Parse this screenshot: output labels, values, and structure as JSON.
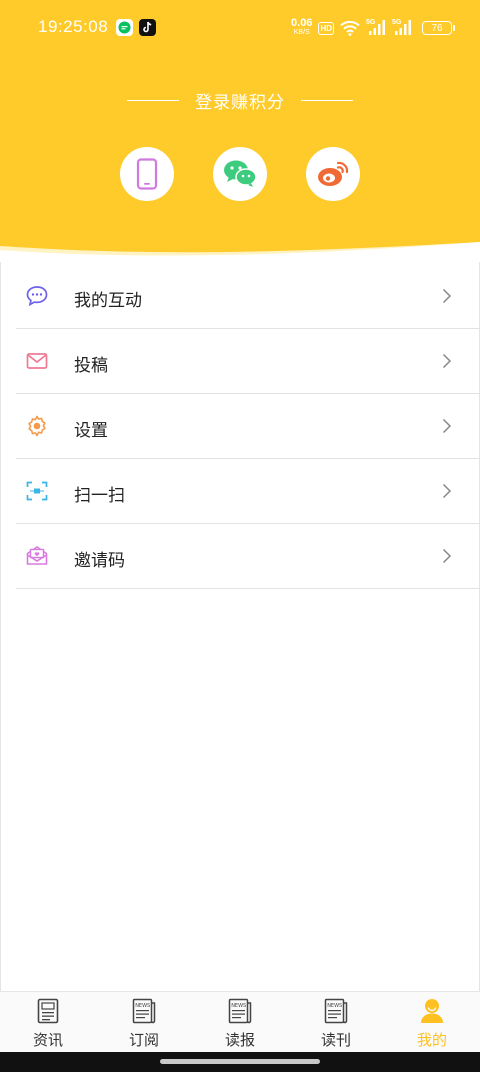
{
  "status_bar": {
    "time": "19:25:08",
    "net_speed_value": "0.06",
    "net_speed_unit": "KB/S",
    "hd_label": "HD",
    "signal_1_label": "5G",
    "signal_2_label": "5G",
    "battery": "76"
  },
  "header": {
    "login_title": "登录赚积分",
    "login_options": [
      "phone-icon",
      "wechat-icon",
      "weibo-icon"
    ],
    "background_color": "#FFCB2B"
  },
  "menu": {
    "items": [
      {
        "label": "我的互动",
        "icon": "chat-bubble-icon"
      },
      {
        "label": "投稿",
        "icon": "envelope-icon"
      },
      {
        "label": "设置",
        "icon": "gear-icon"
      },
      {
        "label": "扫一扫",
        "icon": "scan-icon"
      },
      {
        "label": "邀请码",
        "icon": "invite-mail-icon"
      }
    ]
  },
  "tabbar": {
    "tabs": [
      {
        "label": "资讯",
        "icon": "document-icon"
      },
      {
        "label": "订阅",
        "icon": "newspaper-icon"
      },
      {
        "label": "读报",
        "icon": "newspaper-icon"
      },
      {
        "label": "读刊",
        "icon": "newspaper-icon"
      },
      {
        "label": "我的",
        "icon": "person-icon"
      }
    ],
    "active_index": 4,
    "active_color": "#FFC122"
  }
}
